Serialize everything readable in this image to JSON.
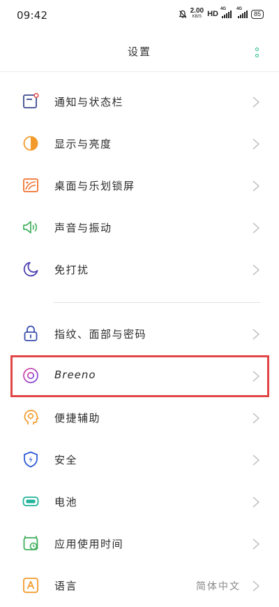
{
  "status_bar": {
    "time": "09:42",
    "net_speed": "2.00",
    "net_speed_unit": "KB/S",
    "hd": "HD",
    "sim1_net": "4G",
    "sim2_net": "4G",
    "battery": "85"
  },
  "header": {
    "title": "设置"
  },
  "items": [
    {
      "label": "通知与状态栏",
      "icon": "notification-icon"
    },
    {
      "label": "显示与亮度",
      "icon": "brightness-icon"
    },
    {
      "label": "桌面与乐划锁屏",
      "icon": "wallpaper-icon"
    },
    {
      "label": "声音与振动",
      "icon": "speaker-icon"
    },
    {
      "label": "免打扰",
      "icon": "moon-icon"
    },
    {
      "label": "指纹、面部与密码",
      "icon": "lock-icon"
    },
    {
      "label": "Breeno",
      "icon": "breeno-icon"
    },
    {
      "label": "便捷辅助",
      "icon": "assist-head-icon"
    },
    {
      "label": "安全",
      "icon": "shield-icon"
    },
    {
      "label": "电池",
      "icon": "battery-icon"
    },
    {
      "label": "应用使用时间",
      "icon": "app-time-icon"
    },
    {
      "label": "语言",
      "icon": "language-icon",
      "value": "简体中文"
    }
  ],
  "colors": {
    "accent": "#22b88a",
    "highlight": "#e24545"
  }
}
